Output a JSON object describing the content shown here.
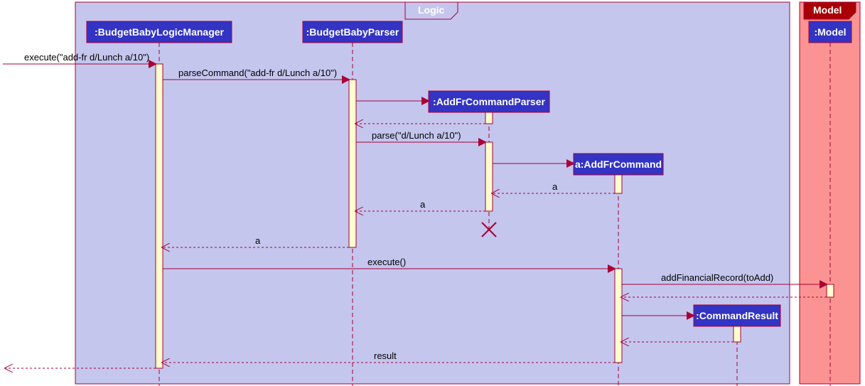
{
  "frames": {
    "logic": {
      "title": "Logic"
    },
    "model": {
      "title": "Model"
    }
  },
  "participants": {
    "logicManager": ":BudgetBabyLogicManager",
    "parser": ":BudgetBabyParser",
    "addFrParser": ":AddFrCommandParser",
    "addFrCommand": "a:AddFrCommand",
    "commandResult": ":CommandResult",
    "model": ":Model"
  },
  "messages": {
    "m1": "execute(\"add-fr d/Lunch a/10\")",
    "m2": "parseCommand(\"add-fr d/Lunch a/10\")",
    "m3": "parse(\"d/Lunch a/10\")",
    "m4": "a",
    "m5": "a",
    "m6": "a",
    "m7": "execute()",
    "m8": "addFinancialRecord(toAdd)",
    "m9": "result"
  }
}
